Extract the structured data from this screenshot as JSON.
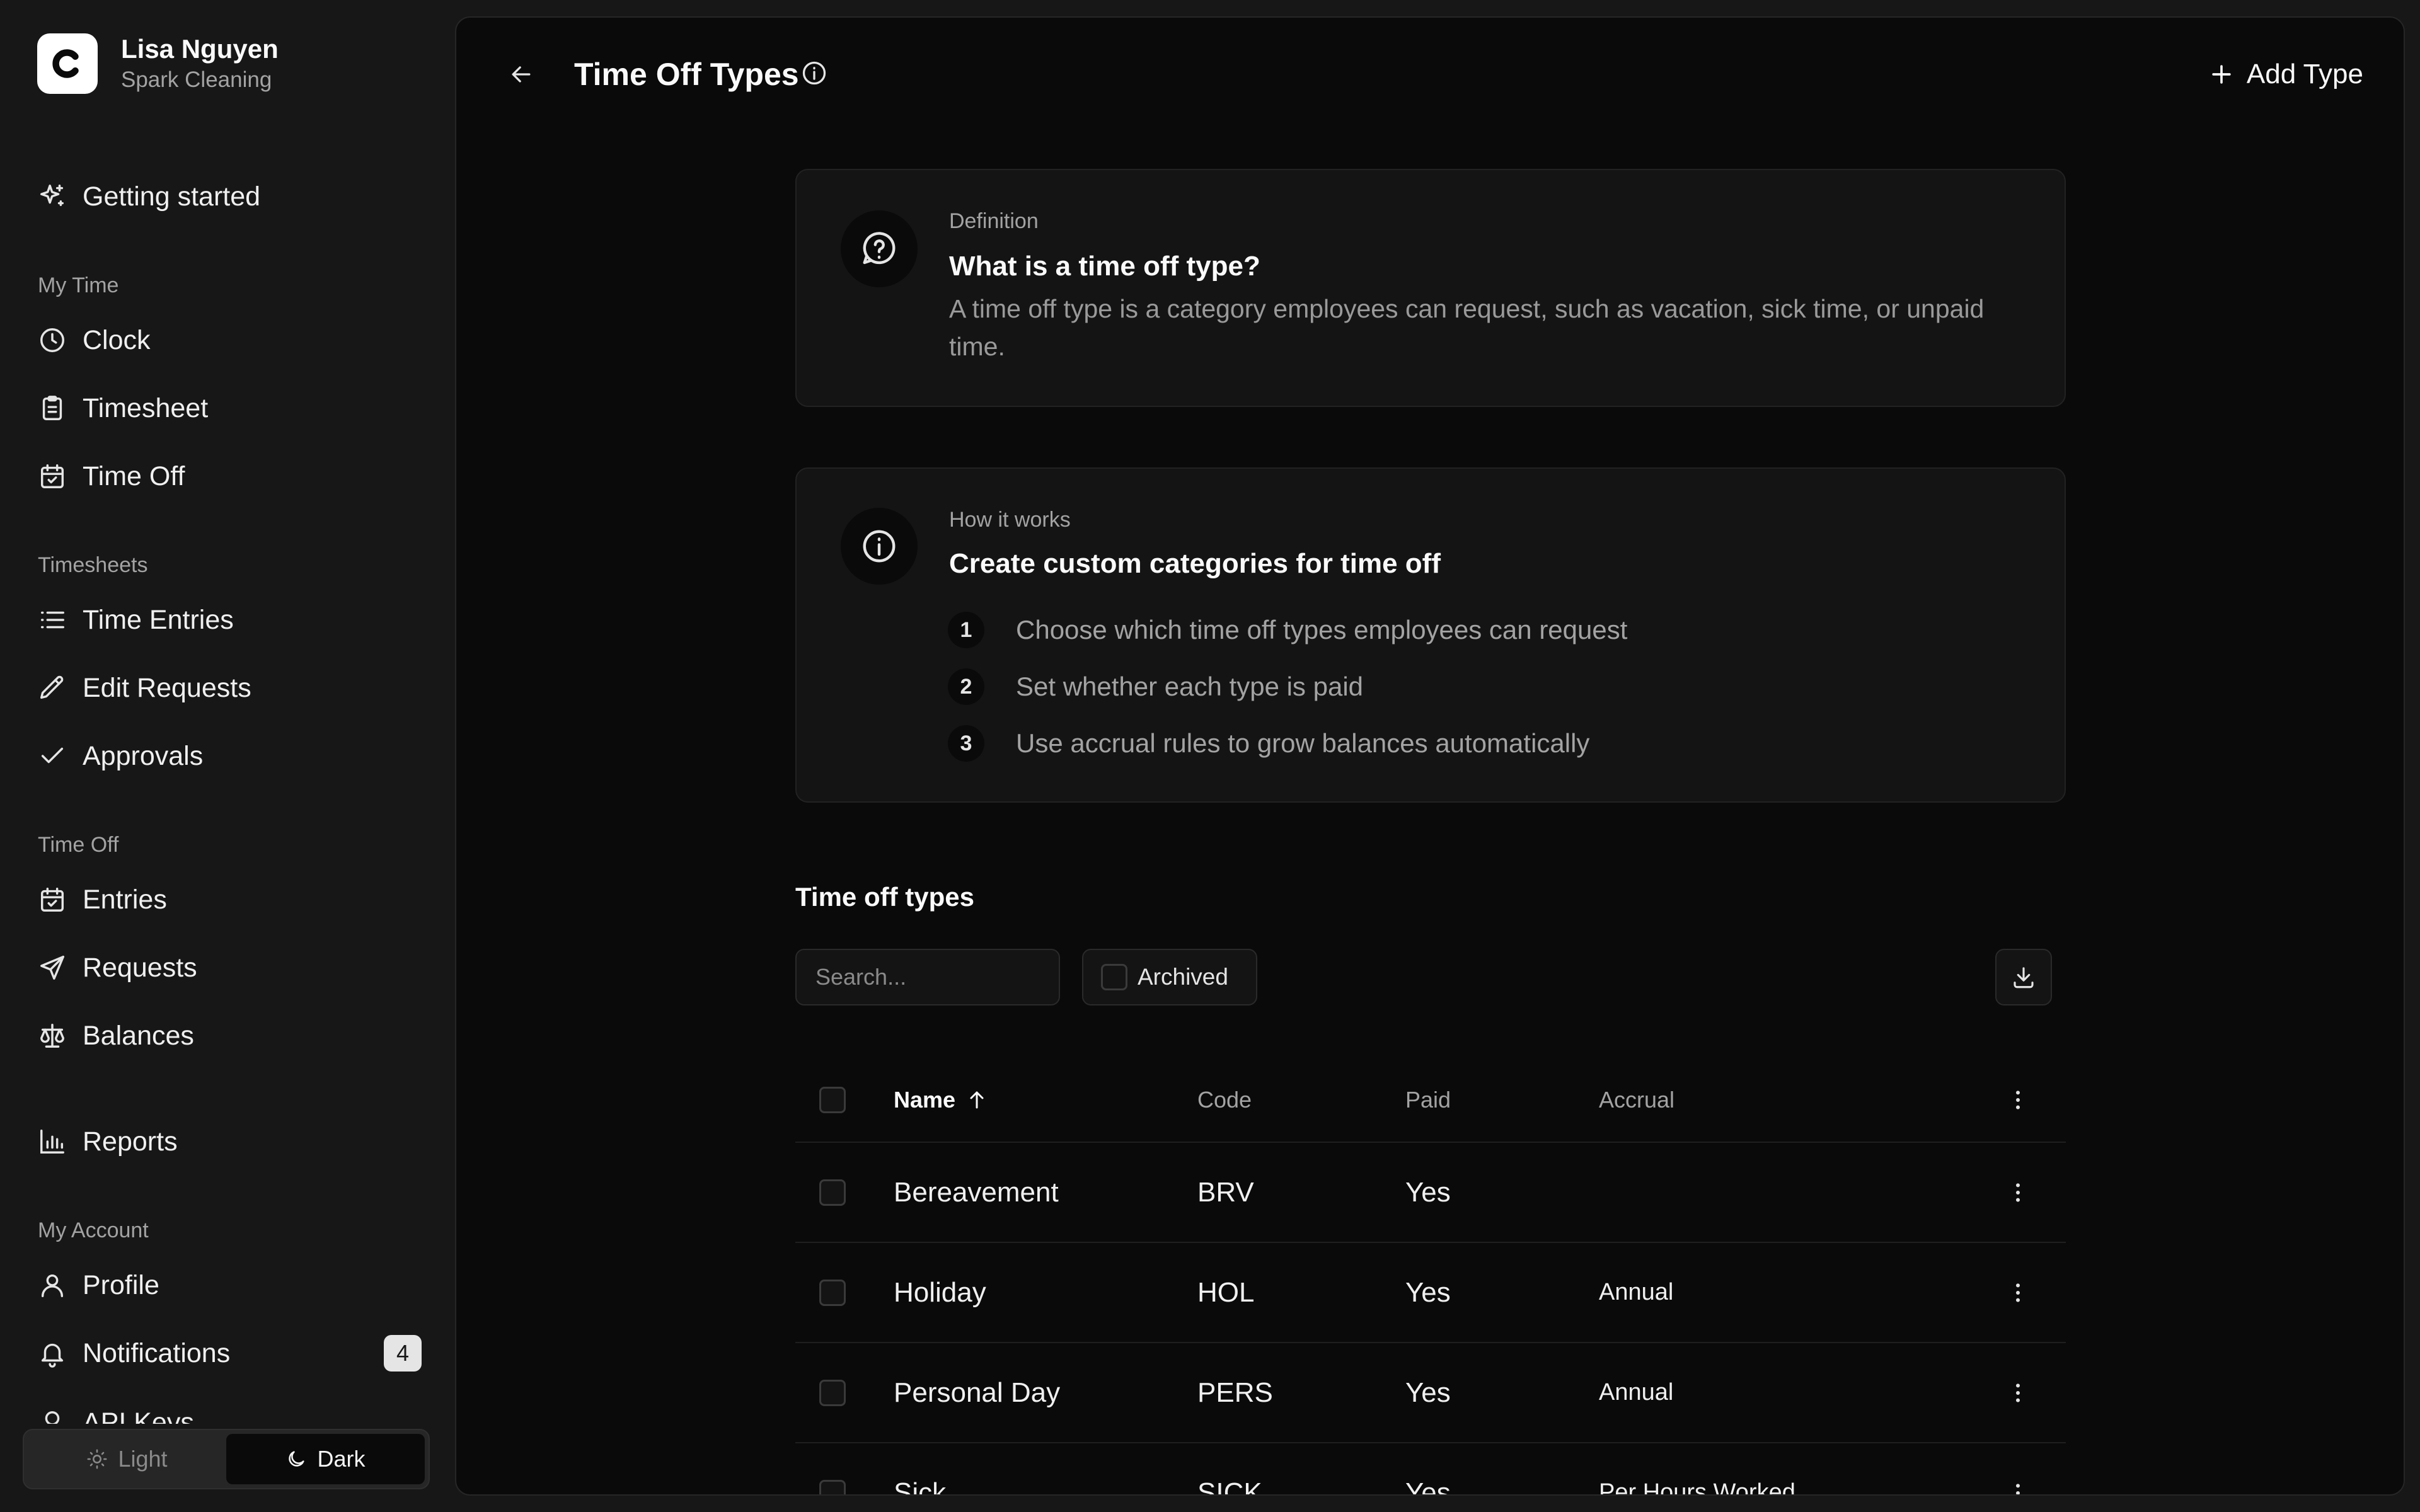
{
  "account": {
    "name": "Lisa Nguyen",
    "org": "Spark Cleaning"
  },
  "nav": {
    "getting_started": "Getting started",
    "sections": {
      "my_time": "My Time",
      "timesheets": "Timesheets",
      "time_off": "Time Off",
      "my_account": "My Account"
    },
    "clock": "Clock",
    "timesheet": "Timesheet",
    "time_off": "Time Off",
    "time_entries": "Time Entries",
    "edit_requests": "Edit Requests",
    "approvals": "Approvals",
    "entries": "Entries",
    "requests": "Requests",
    "balances": "Balances",
    "reports": "Reports",
    "profile": "Profile",
    "notifications": "Notifications",
    "notifications_count": "4",
    "cut_item": "API Keys"
  },
  "theme": {
    "light": "Light",
    "dark": "Dark",
    "selected": "Dark"
  },
  "header": {
    "title": "Time Off Types",
    "add_label": "Add Type"
  },
  "definition_card": {
    "eyebrow": "Definition",
    "heading": "What is a time off type?",
    "body": "A time off type is a category employees can request, such as vacation, sick time, or unpaid time."
  },
  "how_card": {
    "eyebrow": "How it works",
    "heading": "Create custom categories for time off",
    "steps": [
      {
        "num": "1",
        "text": "Choose which time off types employees can request"
      },
      {
        "num": "2",
        "text": "Set whether each type is paid"
      },
      {
        "num": "3",
        "text": "Use accrual rules to grow balances automatically"
      }
    ]
  },
  "list": {
    "title": "Time off types",
    "search_placeholder": "Search...",
    "archived_label": "Archived",
    "archived_checked": false,
    "columns": {
      "name": "Name",
      "code": "Code",
      "paid": "Paid",
      "accrual": "Accrual"
    },
    "sort": {
      "column": "Name",
      "direction": "ascending"
    },
    "rows": [
      {
        "name": "Bereavement",
        "code": "BRV",
        "paid": "Yes",
        "accrual": ""
      },
      {
        "name": "Holiday",
        "code": "HOL",
        "paid": "Yes",
        "accrual": "Annual"
      },
      {
        "name": "Personal Day",
        "code": "PERS",
        "paid": "Yes",
        "accrual": "Annual"
      },
      {
        "name": "Sick",
        "code": "SICK",
        "paid": "Yes",
        "accrual": "Per Hours Worked"
      }
    ]
  },
  "colors": {
    "sidebar_bg": "#171717",
    "main_bg": "#0a0a0a",
    "card_bg": "#141414",
    "text_primary": "#fafafa",
    "text_muted": "#a3a3a3"
  },
  "icons": {
    "logo": "c-logo-icon",
    "getting_started": "sparkles-icon",
    "clock": "clock-icon",
    "timesheet": "clipboard-list-icon",
    "time_off": "calendar-check-icon",
    "time_entries": "list-icon",
    "edit_requests": "pencil-icon",
    "approvals": "check-icon",
    "entries": "calendar-check-icon",
    "requests": "send-icon",
    "balances": "scale-icon",
    "reports": "bar-chart-icon",
    "profile": "user-icon",
    "notifications": "bell-icon",
    "back": "arrow-left-icon",
    "title_info": "info-icon",
    "add": "plus-icon",
    "definition": "message-question-icon",
    "how": "info-icon",
    "download": "download-icon",
    "row_menu": "more-vertical-icon",
    "sort": "arrow-up-icon",
    "light": "sun-icon",
    "dark": "moon-icon"
  }
}
